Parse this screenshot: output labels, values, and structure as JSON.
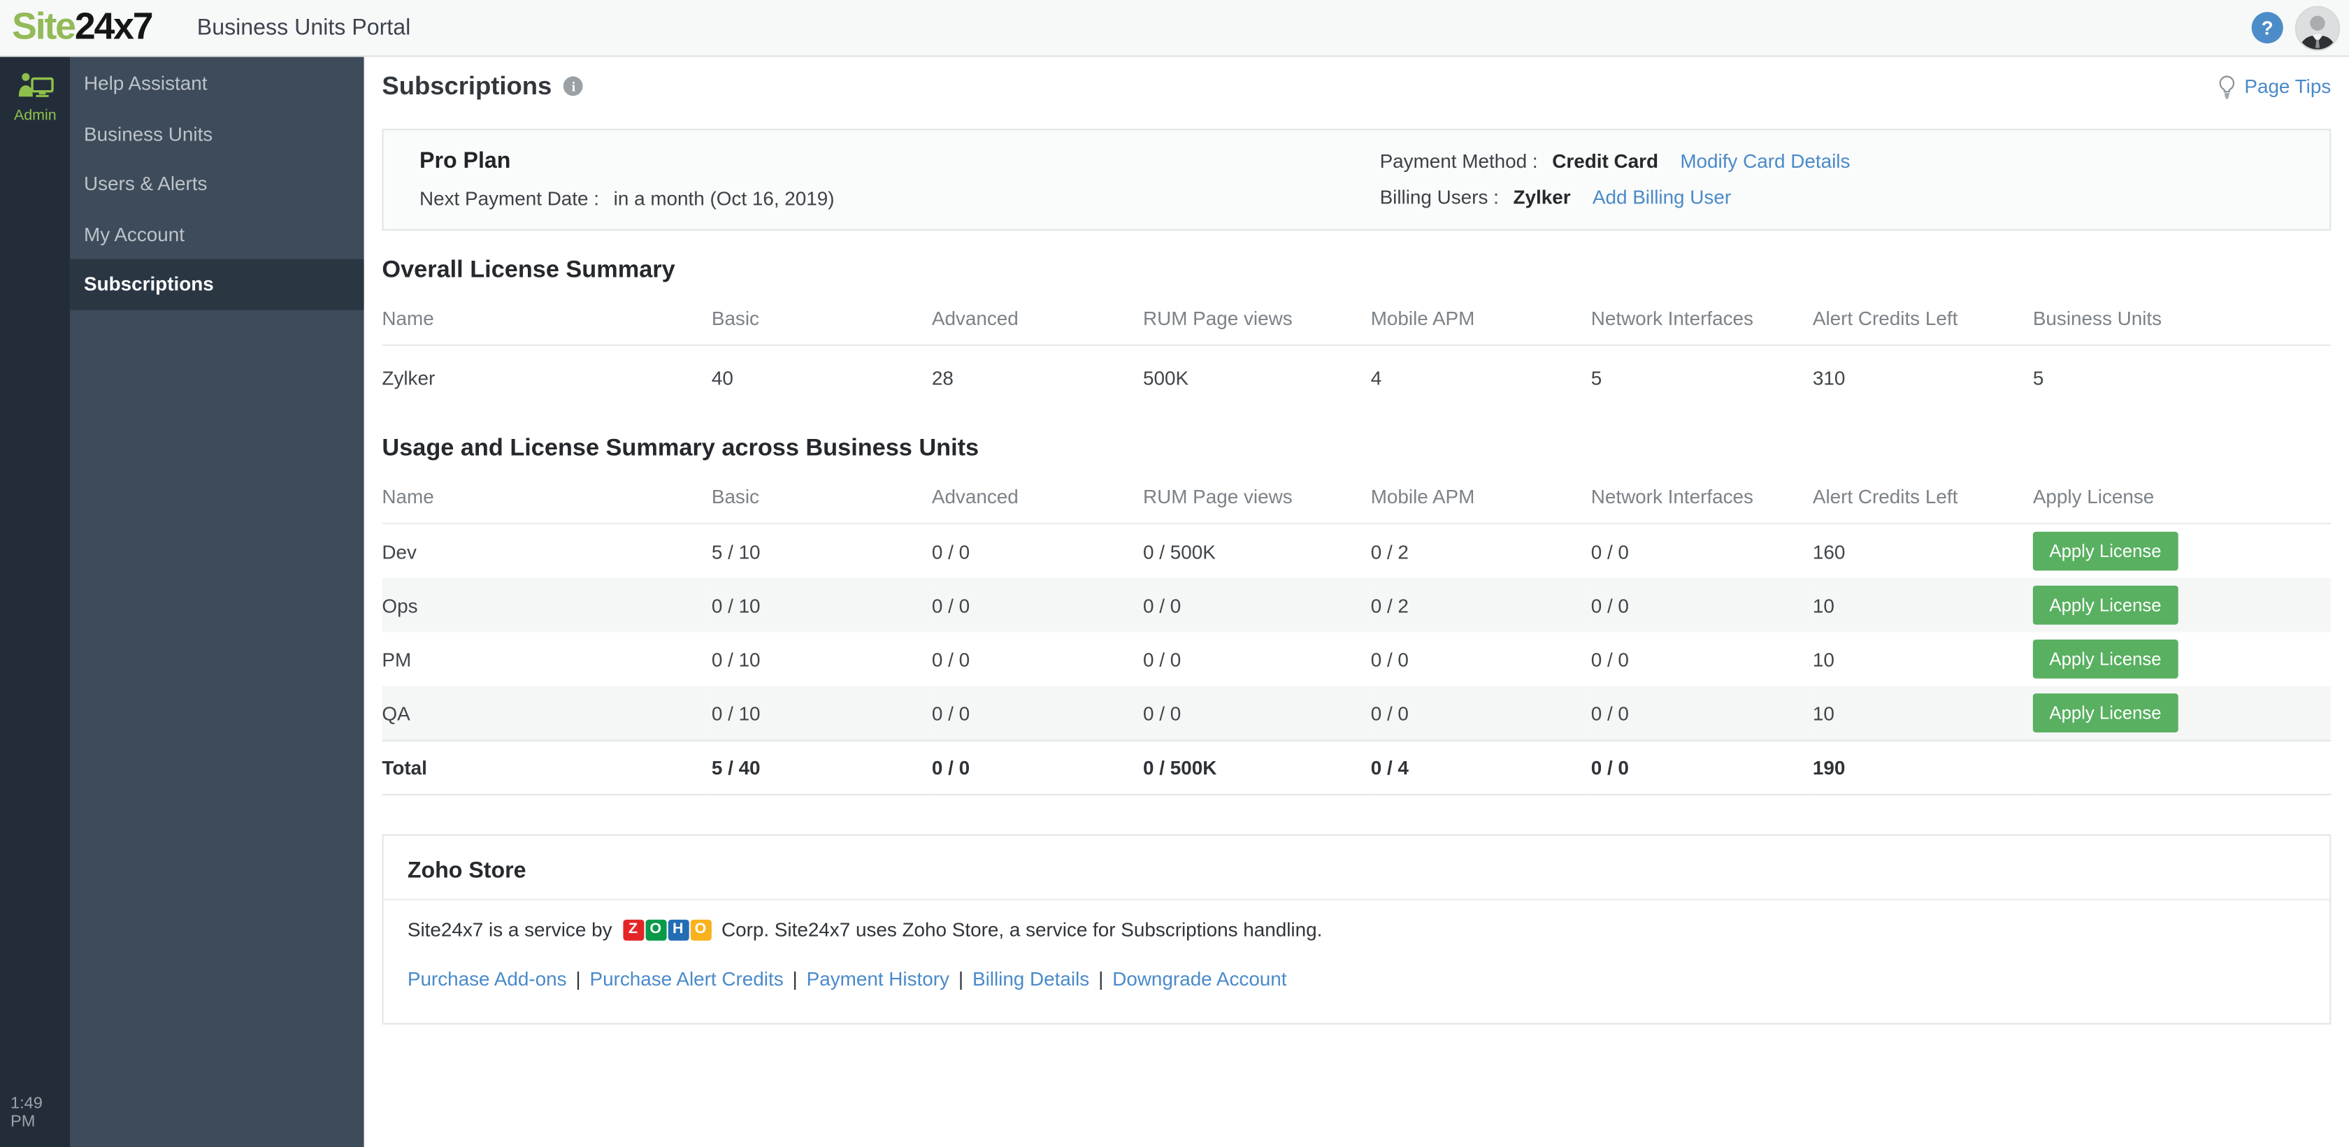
{
  "header": {
    "logo_site": "Site",
    "logo_24x7": "24x7",
    "portal_title": "Business Units Portal",
    "help_glyph": "?"
  },
  "sidebar": {
    "admin_label": "Admin",
    "time": "1:49 PM",
    "items": [
      {
        "label": "Help Assistant",
        "selected": false
      },
      {
        "label": "Business Units",
        "selected": false
      },
      {
        "label": "Users & Alerts",
        "selected": false
      },
      {
        "label": "My Account",
        "selected": false
      },
      {
        "label": "Subscriptions",
        "selected": true
      }
    ]
  },
  "page": {
    "title": "Subscriptions",
    "info_glyph": "i",
    "page_tips": "Page Tips"
  },
  "plan": {
    "name": "Pro Plan",
    "next_payment_label": "Next Payment Date :",
    "next_payment_value": "in a month (Oct 16, 2019)",
    "payment_method_label": "Payment Method :",
    "payment_method_value": "Credit Card",
    "modify_card_link": "Modify Card Details",
    "billing_users_label": "Billing Users :",
    "billing_users_value": "Zylker",
    "add_billing_link": "Add Billing User"
  },
  "overall": {
    "title": "Overall License Summary",
    "columns": [
      "Name",
      "Basic",
      "Advanced",
      "RUM Page views",
      "Mobile APM",
      "Network Interfaces",
      "Alert Credits Left",
      "Business Units"
    ],
    "rows": [
      [
        "Zylker",
        "40",
        "28",
        "500K",
        "4",
        "5",
        "310",
        "5"
      ]
    ]
  },
  "usage": {
    "title": "Usage and License Summary across Business Units",
    "columns": [
      "Name",
      "Basic",
      "Advanced",
      "RUM Page views",
      "Mobile APM",
      "Network Interfaces",
      "Alert Credits Left",
      "Apply License"
    ],
    "rows": [
      {
        "name": "Dev",
        "values": [
          "5 / 10",
          "0 / 0",
          "0 / 500K",
          "0 / 2",
          "0 / 0",
          "160"
        ],
        "button": "Apply License"
      },
      {
        "name": "Ops",
        "values": [
          "0 / 10",
          "0 / 0",
          "0 / 0",
          "0 / 2",
          "0 / 0",
          "10"
        ],
        "button": "Apply License"
      },
      {
        "name": "PM",
        "values": [
          "0 / 10",
          "0 / 0",
          "0 / 0",
          "0 / 0",
          "0 / 0",
          "10"
        ],
        "button": "Apply License"
      },
      {
        "name": "QA",
        "values": [
          "0 / 10",
          "0 / 0",
          "0 / 0",
          "0 / 0",
          "0 / 0",
          "10"
        ],
        "button": "Apply License"
      }
    ],
    "total": {
      "name": "Total",
      "values": [
        "5 / 40",
        "0 / 0",
        "0 / 500K",
        "0 / 4",
        "0 / 0",
        "190"
      ]
    }
  },
  "store": {
    "title": "Zoho Store",
    "text_before": "Site24x7 is a service by",
    "zoho_letters": [
      "Z",
      "O",
      "H",
      "O"
    ],
    "text_after": "Corp.  Site24x7 uses Zoho Store, a service for Subscriptions handling.",
    "separator": "|",
    "links": [
      "Purchase Add-ons",
      "Purchase Alert Credits",
      "Payment History",
      "Billing Details",
      "Downgrade Account"
    ]
  },
  "colors": {
    "brand_green": "#92ba57",
    "button_green": "#58b060",
    "link_blue": "#4a8ac9",
    "rail_bg": "#232d39",
    "sidebar_bg": "#3d4b5a",
    "selected_item_bg": "#2b3643",
    "zoho_tiles": [
      "#e42527",
      "#089949",
      "#226db4",
      "#f9b21d"
    ]
  }
}
